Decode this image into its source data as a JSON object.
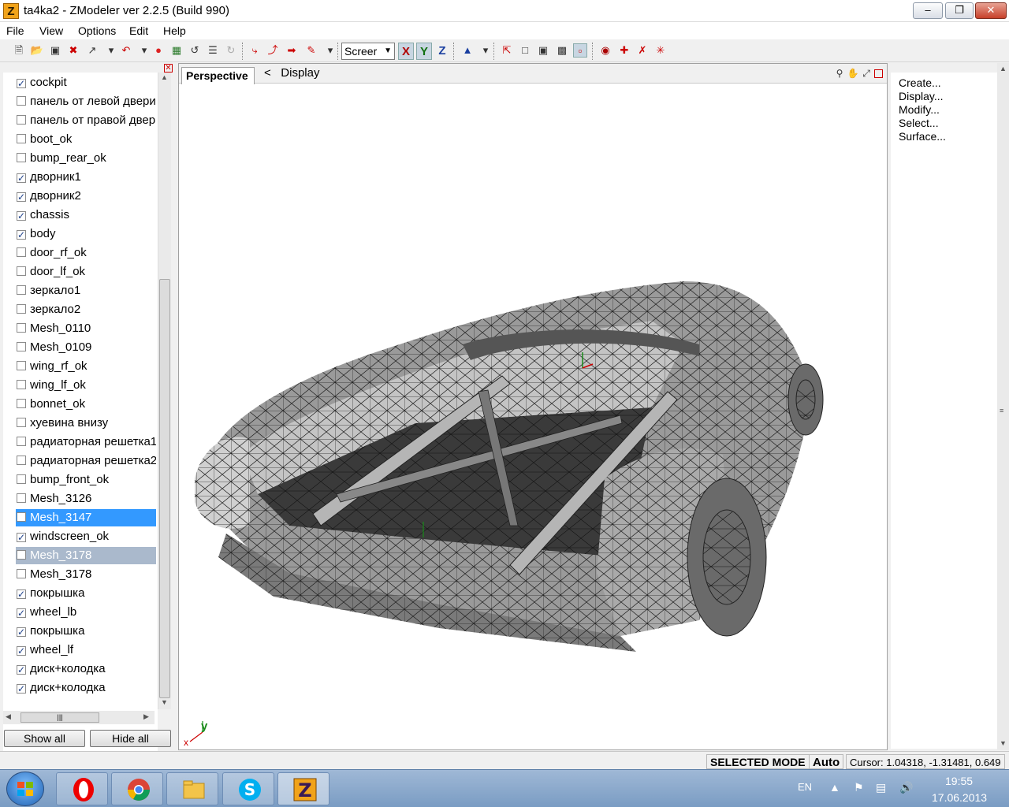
{
  "window": {
    "title": "ta4ka2 - ZModeler ver 2.2.5 (Build 990)",
    "app_icon_letter": "Z"
  },
  "menu": [
    "File",
    "View",
    "Options",
    "Edit",
    "Help"
  ],
  "toolbar": {
    "screen_mode": "Screer",
    "axis_x": "X",
    "axis_y": "Y",
    "axis_z": "Z"
  },
  "left_panel": {
    "objects": [
      {
        "label": "cockpit",
        "checked": true
      },
      {
        "label": "панель от левой двери",
        "checked": false
      },
      {
        "label": "панель от правой двери",
        "checked": false
      },
      {
        "label": "boot_ok",
        "checked": false
      },
      {
        "label": "bump_rear_ok",
        "checked": false
      },
      {
        "label": "дворник1",
        "checked": true
      },
      {
        "label": "дворник2",
        "checked": true
      },
      {
        "label": "chassis",
        "checked": true
      },
      {
        "label": "body",
        "checked": true
      },
      {
        "label": "door_rf_ok",
        "checked": false
      },
      {
        "label": "door_lf_ok",
        "checked": false
      },
      {
        "label": "зеркало1",
        "checked": false
      },
      {
        "label": "зеркало2",
        "checked": false
      },
      {
        "label": "Mesh_0110",
        "checked": false
      },
      {
        "label": "Mesh_0109",
        "checked": false
      },
      {
        "label": "wing_rf_ok",
        "checked": false
      },
      {
        "label": "wing_lf_ok",
        "checked": false
      },
      {
        "label": "bonnet_ok",
        "checked": false
      },
      {
        "label": "хуевина внизу",
        "checked": false
      },
      {
        "label": "радиаторная решетка1",
        "checked": false
      },
      {
        "label": "радиаторная решетка2",
        "checked": false
      },
      {
        "label": "bump_front_ok",
        "checked": false
      },
      {
        "label": "Mesh_3126",
        "checked": false
      },
      {
        "label": "Mesh_3147",
        "checked": false,
        "state": "selected"
      },
      {
        "label": "windscreen_ok",
        "checked": true
      },
      {
        "label": "Mesh_3178",
        "checked": false,
        "state": "selected-inactive"
      },
      {
        "label": "Mesh_3178",
        "checked": false
      },
      {
        "label": "покрышка",
        "checked": true
      },
      {
        "label": "wheel_lb",
        "checked": true
      },
      {
        "label": "покрышка",
        "checked": true
      },
      {
        "label": "wheel_lf",
        "checked": true
      },
      {
        "label": "диск+колодка",
        "checked": true
      },
      {
        "label": "диск+колодка",
        "checked": true
      }
    ],
    "show_all": "Show all",
    "hide_all": "Hide all"
  },
  "viewport": {
    "tab": "Perspective",
    "breadcrumb_back": "<",
    "breadcrumb": "Display",
    "axis_gizmo_y": "y",
    "axis_gizmo_x": "x"
  },
  "right_panel": {
    "items": [
      "Create...",
      "Display...",
      "Modify...",
      "Select...",
      "Surface..."
    ]
  },
  "statusbar": {
    "mode": "SELECTED MODE",
    "auto": "Auto",
    "cursor": "Cursor: 1.04318, -1.31481, 0.649"
  },
  "taskbar": {
    "apps": [
      "opera-icon",
      "chrome-icon",
      "explorer-icon",
      "skype-icon",
      "zmodeler-icon"
    ],
    "lang": "EN",
    "time": "19:55",
    "date": "17.06.2013"
  },
  "colors": {
    "selection": "#3399ff",
    "selection_inactive": "#aab9cc",
    "checkbox_mark": "#1c3f8a"
  }
}
